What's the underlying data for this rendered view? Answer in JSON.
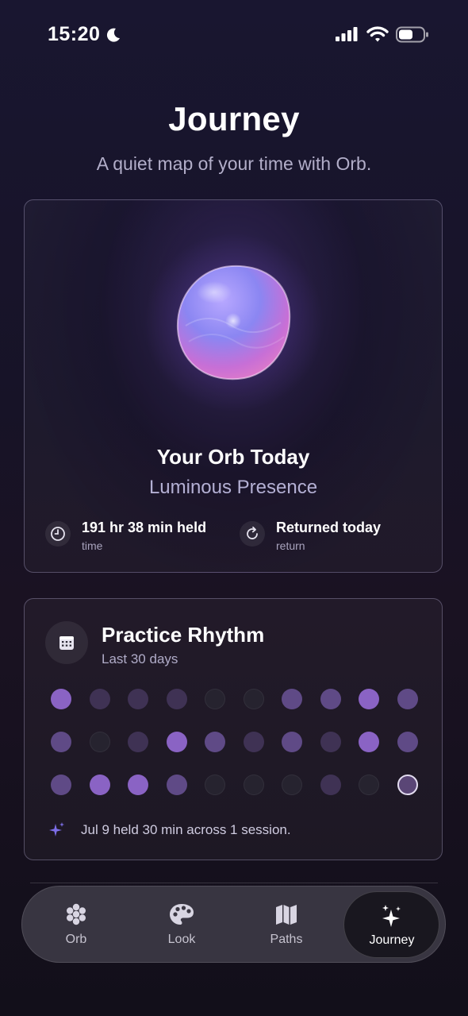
{
  "status_bar": {
    "time": "15:20",
    "icons": [
      "moon-icon",
      "signal-icon",
      "wifi-icon",
      "battery-icon"
    ]
  },
  "header": {
    "title": "Journey",
    "subtitle": "A quiet map of your time with Orb."
  },
  "orb_card": {
    "title": "Your Orb Today",
    "mood": "Luminous Presence",
    "stats": [
      {
        "icon": "clock-icon",
        "value": "191 hr 38 min held",
        "label": "time"
      },
      {
        "icon": "refresh-icon",
        "value": "Returned today",
        "label": "return"
      }
    ]
  },
  "rhythm_card": {
    "icon": "calendar-icon",
    "title": "Practice Rhythm",
    "subtitle": "Last 30 days",
    "levels": [
      3,
      1,
      1,
      1,
      0,
      0,
      2,
      2,
      3,
      2,
      2,
      0,
      1,
      3,
      2,
      1,
      2,
      1,
      3,
      2,
      2,
      3,
      3,
      2,
      0,
      0,
      0,
      1,
      0,
      "today"
    ],
    "note": "Jul 9 held 30 min across 1 session.",
    "colors": {
      "level0": "#26232f",
      "level1": "#3f3254",
      "level2": "#5f4a86",
      "level3": "#8a63c4"
    }
  },
  "tab_bar": {
    "tabs": [
      {
        "label": "Orb",
        "icon": "orb-dots-icon"
      },
      {
        "label": "Look",
        "icon": "palette-icon"
      },
      {
        "label": "Paths",
        "icon": "map-icon"
      },
      {
        "label": "Journey",
        "icon": "sparkles-icon"
      }
    ],
    "active": "Journey"
  }
}
